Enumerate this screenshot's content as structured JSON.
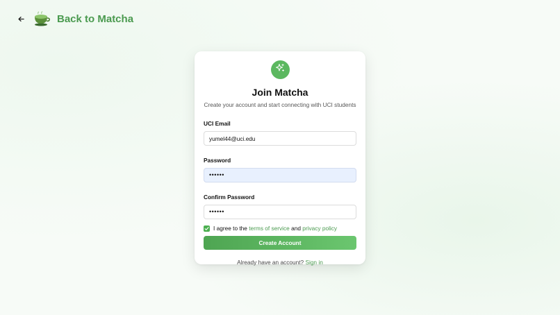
{
  "nav": {
    "back_label": "Back to Matcha"
  },
  "form": {
    "title": "Join Matcha",
    "subtitle": "Create your account and start connecting with UCI students",
    "email_label": "UCI Email",
    "email_value": "yumel44@uci.edu",
    "password_label": "Password",
    "password_value": "••••••",
    "confirm_label": "Confirm Password",
    "confirm_value": "••••••",
    "agree_prefix": "I agree to the",
    "terms_link": "terms of service",
    "agree_and": "and",
    "privacy_link": "privacy policy",
    "agree_checked": true,
    "submit_label": "Create Account",
    "signin_prompt": "Already have an account?",
    "signin_link": "Sign in"
  },
  "colors": {
    "accent": "#4a9a4f",
    "button": "#5cb860",
    "autofill": "#e8f0fe"
  }
}
